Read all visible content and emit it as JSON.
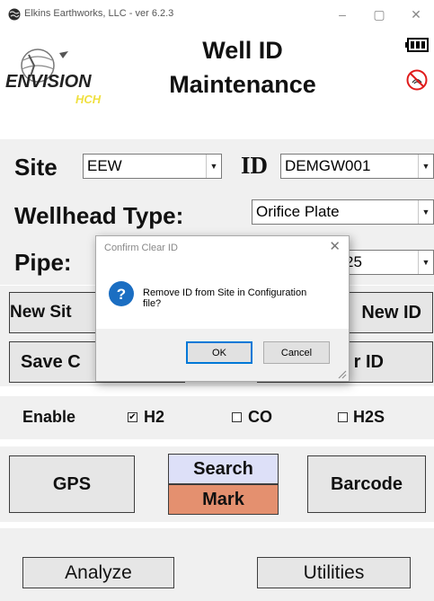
{
  "window": {
    "title": "Elkins Earthworks, LLC - ver 6.2.3",
    "minimize": "–",
    "maximize": "▢",
    "close": "✕"
  },
  "header": {
    "title_line1": "Well ID",
    "title_line2": "Maintenance",
    "logo_text": "ENVISION",
    "logo_sub": "HCH"
  },
  "form": {
    "site_label": "Site",
    "site_value": "EEW",
    "id_label": "ID",
    "id_value": "DEMGW001",
    "wellhead_label": "Wellhead Type:",
    "wellhead_value": "Orifice Plate",
    "pipe_label": "Pipe:",
    "pipe_value": "25"
  },
  "buttons": {
    "new_site": "New Sit",
    "new_id": "New ID",
    "save": "Save C",
    "clear_id": "r ID",
    "gps": "GPS",
    "search": "Search",
    "mark": "Mark",
    "barcode": "Barcode",
    "analyze": "Analyze",
    "utilities": "Utilities"
  },
  "enable": {
    "label": "Enable",
    "h2_label": "H2",
    "h2_checked": true,
    "co_label": "CO",
    "co_checked": false,
    "h2s_label": "H2S",
    "h2s_checked": false
  },
  "dialog": {
    "title": "Confirm Clear ID",
    "close": "✕",
    "message_line1": "Remove ID from Site in Configuration",
    "message_line2": "file?",
    "ok": "OK",
    "cancel": "Cancel"
  },
  "colors": {
    "search_bg": "#dde0f8",
    "mark_bg": "#e4906f",
    "panel_bg": "#f0f0f0",
    "dialog_accent": "#0078d7",
    "info_icon": "#1b6ec2"
  }
}
